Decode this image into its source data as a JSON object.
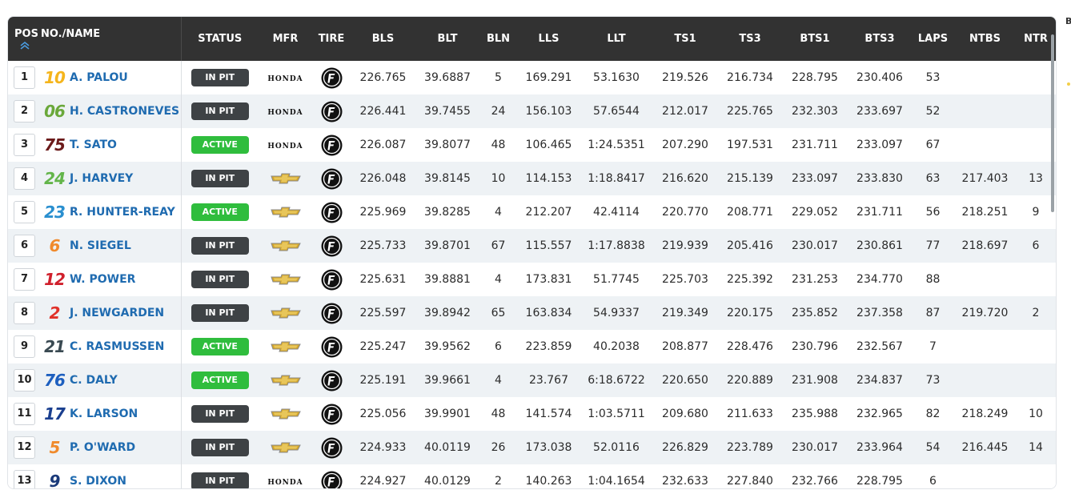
{
  "columns": {
    "pos": "POS",
    "name": "NO./NAME",
    "status": "STATUS",
    "mfr": "MFR",
    "tire": "TIRE",
    "bls": "BLS",
    "blt": "BLT",
    "bln": "BLN",
    "lls": "LLS",
    "llt": "LLT",
    "ts1": "TS1",
    "ts3": "TS3",
    "bts1": "BTS1",
    "bts3": "BTS3",
    "laps": "LAPS",
    "ntbs": "NTBS",
    "ntr": "NTR"
  },
  "sort_icon": "double-chevron-up-icon",
  "edge_text": "B",
  "colors": {
    "header_bg": "#323232",
    "active": "#2fbd3d",
    "in_pit": "#3e4245",
    "driver_link": "#1f6bb0",
    "row_alt": "#eef2f5"
  },
  "rows": [
    {
      "pos": "1",
      "num": "10",
      "num_color": "#f5b51c",
      "name": "A. PALOU",
      "status": "IN PIT",
      "status_type": "in-pit",
      "mfr": "HONDA",
      "mfr_type": "honda",
      "tire": "firestone-icon",
      "bls": "226.765",
      "blt": "39.6887",
      "bln": "5",
      "lls": "169.291",
      "llt": "53.1630",
      "ts1": "219.526",
      "ts3": "216.734",
      "bts1": "228.795",
      "bts3": "230.406",
      "laps": "53",
      "ntbs": "",
      "ntr": ""
    },
    {
      "pos": "2",
      "num": "06",
      "num_color": "#6aa83a",
      "name": "H. CASTRONEVES",
      "status": "IN PIT",
      "status_type": "in-pit",
      "mfr": "HONDA",
      "mfr_type": "honda",
      "tire": "firestone-icon",
      "bls": "226.441",
      "blt": "39.7455",
      "bln": "24",
      "lls": "156.103",
      "llt": "57.6544",
      "ts1": "212.017",
      "ts3": "225.765",
      "bts1": "232.303",
      "bts3": "233.697",
      "laps": "52",
      "ntbs": "",
      "ntr": ""
    },
    {
      "pos": "3",
      "num": "75",
      "num_color": "#6b1a1a",
      "name": "T. SATO",
      "status": "ACTIVE",
      "status_type": "active",
      "mfr": "HONDA",
      "mfr_type": "honda",
      "tire": "firestone-icon",
      "bls": "226.087",
      "blt": "39.8077",
      "bln": "48",
      "lls": "106.465",
      "llt": "1:24.5351",
      "ts1": "207.290",
      "ts3": "197.531",
      "bts1": "231.711",
      "bts3": "233.097",
      "laps": "67",
      "ntbs": "",
      "ntr": ""
    },
    {
      "pos": "4",
      "num": "24",
      "num_color": "#63b54a",
      "name": "J. HARVEY",
      "status": "IN PIT",
      "status_type": "in-pit",
      "mfr": "CHEVROLET",
      "mfr_type": "chevy",
      "tire": "firestone-icon",
      "bls": "226.048",
      "blt": "39.8145",
      "bln": "10",
      "lls": "114.153",
      "llt": "1:18.8417",
      "ts1": "216.620",
      "ts3": "215.139",
      "bts1": "233.097",
      "bts3": "233.830",
      "laps": "63",
      "ntbs": "217.403",
      "ntr": "13"
    },
    {
      "pos": "5",
      "num": "23",
      "num_color": "#2a8fcf",
      "name": "R. HUNTER-REAY",
      "status": "ACTIVE",
      "status_type": "active",
      "mfr": "CHEVROLET",
      "mfr_type": "chevy",
      "tire": "firestone-icon",
      "bls": "225.969",
      "blt": "39.8285",
      "bln": "4",
      "lls": "212.207",
      "llt": "42.4114",
      "ts1": "220.770",
      "ts3": "208.771",
      "bts1": "229.052",
      "bts3": "231.711",
      "laps": "56",
      "ntbs": "218.251",
      "ntr": "9"
    },
    {
      "pos": "6",
      "num": "6",
      "num_color": "#f08a2c",
      "name": "N. SIEGEL",
      "status": "IN PIT",
      "status_type": "in-pit",
      "mfr": "CHEVROLET",
      "mfr_type": "chevy",
      "tire": "firestone-icon",
      "bls": "225.733",
      "blt": "39.8701",
      "bln": "67",
      "lls": "115.557",
      "llt": "1:17.8838",
      "ts1": "219.939",
      "ts3": "205.416",
      "bts1": "230.017",
      "bts3": "230.861",
      "laps": "77",
      "ntbs": "218.697",
      "ntr": "6"
    },
    {
      "pos": "7",
      "num": "12",
      "num_color": "#d0202c",
      "name": "W. POWER",
      "status": "IN PIT",
      "status_type": "in-pit",
      "mfr": "CHEVROLET",
      "mfr_type": "chevy",
      "tire": "firestone-icon",
      "bls": "225.631",
      "blt": "39.8881",
      "bln": "4",
      "lls": "173.831",
      "llt": "51.7745",
      "ts1": "225.703",
      "ts3": "225.392",
      "bts1": "231.253",
      "bts3": "234.770",
      "laps": "88",
      "ntbs": "",
      "ntr": ""
    },
    {
      "pos": "8",
      "num": "2",
      "num_color": "#e0322a",
      "name": "J. NEWGARDEN",
      "status": "IN PIT",
      "status_type": "in-pit",
      "mfr": "CHEVROLET",
      "mfr_type": "chevy",
      "tire": "firestone-icon",
      "bls": "225.597",
      "blt": "39.8942",
      "bln": "65",
      "lls": "163.834",
      "llt": "54.9337",
      "ts1": "219.349",
      "ts3": "220.175",
      "bts1": "235.852",
      "bts3": "237.358",
      "laps": "87",
      "ntbs": "219.720",
      "ntr": "2"
    },
    {
      "pos": "9",
      "num": "21",
      "num_color": "#3a4a52",
      "name": "C. RASMUSSEN",
      "status": "ACTIVE",
      "status_type": "active",
      "mfr": "CHEVROLET",
      "mfr_type": "chevy",
      "tire": "firestone-icon",
      "bls": "225.247",
      "blt": "39.9562",
      "bln": "6",
      "lls": "223.859",
      "llt": "40.2038",
      "ts1": "208.877",
      "ts3": "228.476",
      "bts1": "230.796",
      "bts3": "232.567",
      "laps": "7",
      "ntbs": "",
      "ntr": ""
    },
    {
      "pos": "10",
      "num": "76",
      "num_color": "#1d5fbf",
      "name": "C. DALY",
      "status": "ACTIVE",
      "status_type": "active",
      "mfr": "CHEVROLET",
      "mfr_type": "chevy",
      "tire": "firestone-icon",
      "bls": "225.191",
      "blt": "39.9661",
      "bln": "4",
      "lls": "23.767",
      "llt": "6:18.6722",
      "ts1": "220.650",
      "ts3": "220.889",
      "bts1": "231.908",
      "bts3": "234.837",
      "laps": "73",
      "ntbs": "",
      "ntr": ""
    },
    {
      "pos": "11",
      "num": "17",
      "num_color": "#1a3f8f",
      "name": "K. LARSON",
      "status": "IN PIT",
      "status_type": "in-pit",
      "mfr": "CHEVROLET",
      "mfr_type": "chevy",
      "tire": "firestone-icon",
      "bls": "225.056",
      "blt": "39.9901",
      "bln": "48",
      "lls": "141.574",
      "llt": "1:03.5711",
      "ts1": "209.680",
      "ts3": "211.633",
      "bts1": "235.988",
      "bts3": "232.965",
      "laps": "82",
      "ntbs": "218.249",
      "ntr": "10"
    },
    {
      "pos": "12",
      "num": "5",
      "num_color": "#f08a2c",
      "name": "P. O'WARD",
      "status": "IN PIT",
      "status_type": "in-pit",
      "mfr": "CHEVROLET",
      "mfr_type": "chevy",
      "tire": "firestone-icon",
      "bls": "224.933",
      "blt": "40.0119",
      "bln": "26",
      "lls": "173.038",
      "llt": "52.0116",
      "ts1": "226.829",
      "ts3": "223.789",
      "bts1": "230.017",
      "bts3": "233.964",
      "laps": "54",
      "ntbs": "216.445",
      "ntr": "14"
    },
    {
      "pos": "13",
      "num": "9",
      "num_color": "#1a3a7a",
      "name": "S. DIXON",
      "status": "IN PIT",
      "status_type": "in-pit",
      "mfr": "HONDA",
      "mfr_type": "honda",
      "tire": "firestone-icon",
      "bls": "224.927",
      "blt": "40.0129",
      "bln": "2",
      "lls": "140.263",
      "llt": "1:04.1654",
      "ts1": "232.633",
      "ts3": "227.840",
      "bts1": "232.766",
      "bts3": "228.795",
      "laps": "6",
      "ntbs": "",
      "ntr": ""
    }
  ]
}
